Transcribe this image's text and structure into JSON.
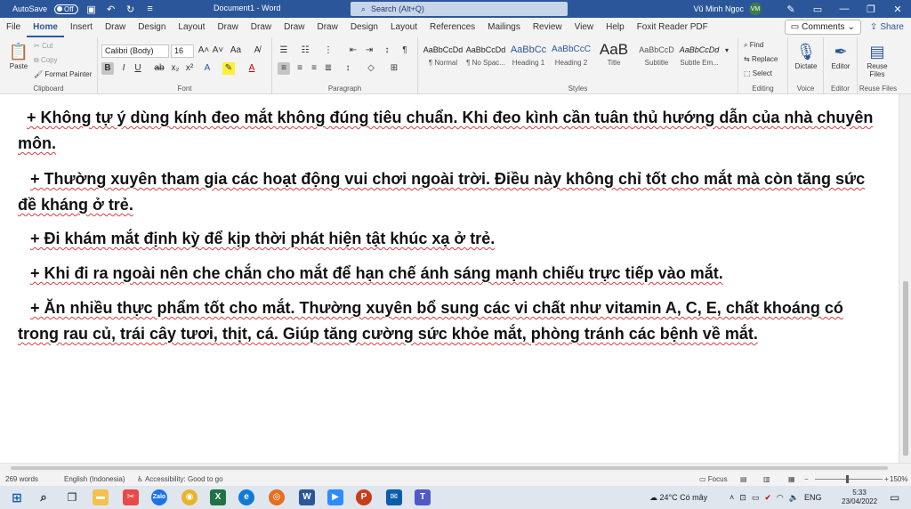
{
  "titlebar": {
    "autosave_label": "AutoSave",
    "autosave_state": "Off",
    "doc_title": "Document1 - Word",
    "search_placeholder": "Search (Alt+Q)",
    "user_name": "Vũ Minh Ngọc",
    "user_initials": "VM"
  },
  "tabs": [
    "File",
    "Home",
    "Insert",
    "Draw",
    "Design",
    "Layout",
    "Draw",
    "Draw",
    "Draw",
    "Draw",
    "Design",
    "Layout",
    "References",
    "Mailings",
    "Review",
    "View",
    "Help",
    "Foxit Reader PDF"
  ],
  "tabs_right": {
    "comments": "Comments",
    "share": "Share"
  },
  "ribbon": {
    "clipboard": {
      "paste": "Paste",
      "cut": "Cut",
      "copy": "Copy",
      "format_painter": "Format Painter",
      "label": "Clipboard"
    },
    "font": {
      "family": "Calibri (Body)",
      "size": "16",
      "label": "Font"
    },
    "paragraph": {
      "label": "Paragraph"
    },
    "styles": {
      "items": [
        {
          "sample": "AaBbCcDd",
          "name": "¶ Normal"
        },
        {
          "sample": "AaBbCcDd",
          "name": "¶ No Spac..."
        },
        {
          "sample": "AaBbCc",
          "name": "Heading 1"
        },
        {
          "sample": "AaBbCcC",
          "name": "Heading 2"
        },
        {
          "sample": "AaB",
          "name": "Title"
        },
        {
          "sample": "AaBbCcD",
          "name": "Subtitle"
        },
        {
          "sample": "AaBbCcDd",
          "name": "Subtle Em..."
        }
      ],
      "label": "Styles"
    },
    "editing": {
      "find": "Find",
      "replace": "Replace",
      "select": "Select",
      "label": "Editing"
    },
    "voice": {
      "dictate": "Dictate",
      "label": "Voice"
    },
    "editor": {
      "editor": "Editor",
      "label": "Editor"
    },
    "reuse": {
      "reuse": "Reuse Files",
      "label": "Reuse Files"
    }
  },
  "document": {
    "paragraphs": [
      "+ Không tự ý dùng kính đeo mắt không đúng tiêu chuẩn. Khi đeo kình cần tuân thủ hướng dẫn của nhà chuyên môn.",
      "+  Thường xuyên tham gia các hoạt động vui chơi ngoài trời. Điều này không chỉ tốt cho mắt mà còn tăng sức đề kháng ở trẻ.",
      "+  Đi khám mắt định kỳ để kịp thời phát hiện tật khúc xạ ở trẻ.",
      "+  Khi đi ra ngoài nên che chắn cho mắt để hạn chế ánh sáng mạnh chiếu trực tiếp vào mắt.",
      "+  Ăn nhiều thực phẩm tốt cho mắt. Thường xuyên bổ sung các vi chất như vitamin A, C, E, chất khoáng có trong rau củ, trái cây tươi, thịt, cá. Giúp tăng cường sức khỏe mắt, phòng tránh các bệnh về mắt."
    ]
  },
  "statusbar": {
    "words": "269 words",
    "language": "English (Indonesia)",
    "accessibility": "Accessibility: Good to go",
    "focus": "Focus",
    "zoom": "150%"
  },
  "taskbar": {
    "weather": "24°C  Có mây",
    "lang": "ENG",
    "time": "5:33",
    "date": "23/04/2022"
  }
}
